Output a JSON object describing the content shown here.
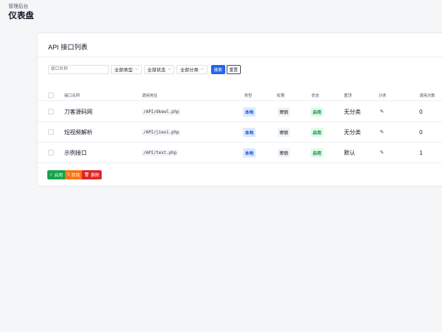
{
  "header": {
    "subtitle": "管理后台",
    "title": "仪表盘"
  },
  "card": {
    "title": "API 接口列表"
  },
  "filters": {
    "name_placeholder": "接口名称",
    "type_select": "全部类型",
    "status_select": "全部状态",
    "category_select": "全部分类",
    "search_label": "搜索",
    "reset_label": "重置"
  },
  "columns": [
    "接口名称",
    "调用地址",
    "类型",
    "权限",
    "状态",
    "置顶",
    "分类",
    "调用次数"
  ],
  "rows": [
    {
      "name": "刀客源码网",
      "address": "/API/dkewl.php",
      "type": "本地",
      "permission": "密钥",
      "status": "启用",
      "pinned": "无分类",
      "category": "✎",
      "calls": "0"
    },
    {
      "name": "短视频解析",
      "address": "/API/jiexi.php",
      "type": "本地",
      "permission": "密钥",
      "status": "启用",
      "pinned": "无分类",
      "category": "✎",
      "calls": "0"
    },
    {
      "name": "示例接口",
      "address": "/API/test.php",
      "type": "本地",
      "permission": "密钥",
      "status": "启用",
      "pinned": "默认",
      "category": "✎",
      "calls": "1"
    }
  ],
  "bulk_actions": {
    "enable_label": "启用",
    "disable_label": "禁用",
    "delete_label": "删除"
  },
  "colors": {
    "primary": "#2563eb",
    "enable": "#16a34a",
    "disable": "#f97316",
    "delete": "#dc2626"
  }
}
